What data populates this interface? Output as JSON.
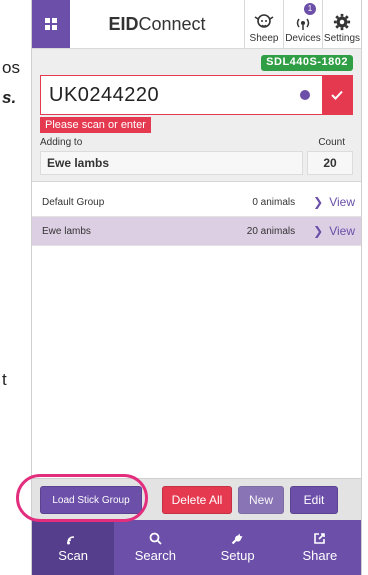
{
  "background": {
    "fragment_1": "os",
    "fragment_2": "s.",
    "fragment_3": "t"
  },
  "header": {
    "title_bold": "EID",
    "title_rest": "Connect",
    "icons": [
      {
        "label": "Sheep",
        "icon": "sheep-icon"
      },
      {
        "label": "Devices",
        "icon": "devices-icon",
        "badge": "1"
      },
      {
        "label": "Settings",
        "icon": "gear-icon"
      }
    ]
  },
  "scan": {
    "reader": "SDL440S-1802",
    "eid_value": "UK0244220",
    "error": "Please scan or enter",
    "adding_to_label": "Adding to",
    "count_label": "Count",
    "group_value": "Ewe lambs",
    "count_value": "20"
  },
  "groups": [
    {
      "name": "Default Group",
      "count": "0 animals",
      "action": "View"
    },
    {
      "name": "Ewe lambs",
      "count": "20 animals",
      "action": "View"
    }
  ],
  "actions": {
    "load": "Load Stick Group",
    "delete_all": "Delete All",
    "new": "New",
    "edit": "Edit"
  },
  "nav": [
    {
      "label": "Scan",
      "icon": "scan-icon",
      "active": true
    },
    {
      "label": "Search",
      "icon": "search-icon"
    },
    {
      "label": "Setup",
      "icon": "wrench-icon"
    },
    {
      "label": "Share",
      "icon": "share-icon"
    }
  ],
  "colors": {
    "accent": "#6b4fa8",
    "danger": "#e53950",
    "reader_green": "#2f9e44",
    "highlight": "#e22e7d"
  }
}
